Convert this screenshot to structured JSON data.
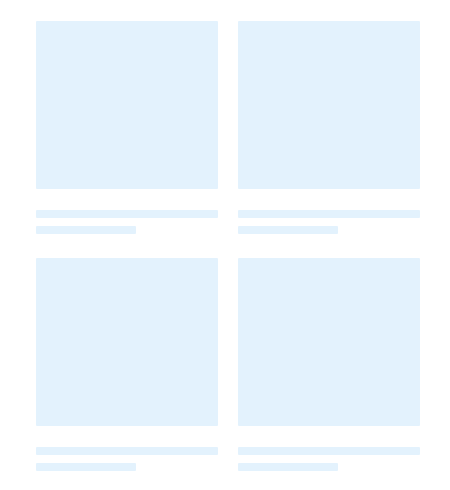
{
  "colors": {
    "placeholder_fill": "#e3f2fd",
    "background": "#ffffff"
  },
  "state": "loading-skeleton",
  "cards": [
    {
      "kind": "skeleton-card"
    },
    {
      "kind": "skeleton-card"
    },
    {
      "kind": "skeleton-card"
    },
    {
      "kind": "skeleton-card"
    }
  ]
}
